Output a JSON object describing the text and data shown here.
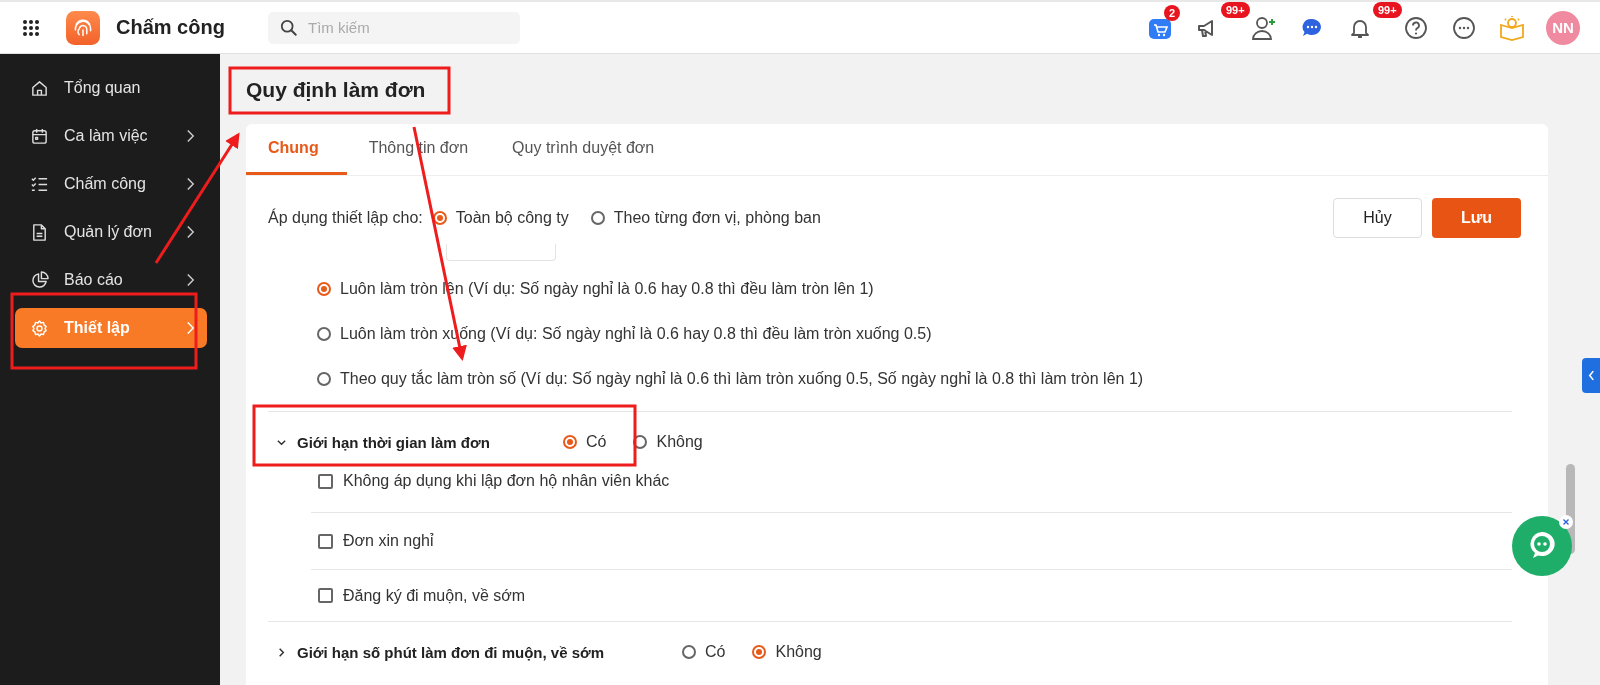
{
  "header": {
    "app_name": "Chấm công",
    "search": {
      "placeholder": "Tìm kiếm"
    },
    "badges": [
      {
        "kind": "cart",
        "count": "2"
      },
      {
        "kind": "megaphone",
        "count": "99+"
      },
      {
        "kind": "add-user"
      },
      {
        "kind": "chat"
      },
      {
        "kind": "bell",
        "count": "99+"
      },
      {
        "kind": "help"
      },
      {
        "kind": "more"
      },
      {
        "kind": "guide"
      }
    ],
    "avatar": "NN"
  },
  "sidebar": {
    "items": [
      {
        "label": "Tổng quan",
        "expandable": false,
        "selected": false
      },
      {
        "label": "Ca làm việc",
        "expandable": true,
        "selected": false
      },
      {
        "label": "Chấm công",
        "expandable": true,
        "selected": false
      },
      {
        "label": "Quản lý đơn",
        "expandable": true,
        "selected": false
      },
      {
        "label": "Báo cáo",
        "expandable": true,
        "selected": false
      },
      {
        "label": "Thiết lập",
        "expandable": true,
        "selected": true
      }
    ]
  },
  "page_title": "Quy định làm đơn",
  "tabs": [
    {
      "label": "Chung",
      "selected": true
    },
    {
      "label": "Thông tin đơn",
      "selected": false
    },
    {
      "label": "Quy trình duyệt đơn",
      "selected": false
    }
  ],
  "apply_to": {
    "label": "Áp dụng thiết lập cho:",
    "options": [
      {
        "label": "Toàn bộ công ty",
        "selected": true
      },
      {
        "label": "Theo từng đơn vị, phòng ban",
        "selected": false
      }
    ]
  },
  "buttons": {
    "cancel": "Hủy",
    "save": "Lưu"
  },
  "rounding_options": [
    {
      "label": "Luôn làm tròn lên (Ví dụ: Số ngày nghỉ là 0.6 hay 0.8 thì đều làm tròn lên 1)",
      "selected": true
    },
    {
      "label": "Luôn làm tròn xuống (Ví dụ: Số ngày nghỉ là 0.6 hay 0.8 thì đều làm tròn xuống 0.5)",
      "selected": false
    },
    {
      "label": "Theo quy tắc làm tròn số (Ví dụ: Số ngày nghỉ là 0.6 thì làm tròn xuống 0.5, Số ngày nghỉ là 0.8 thì làm tròn lên 1)",
      "selected": false
    }
  ],
  "sections": [
    {
      "title": "Giới hạn thời gian làm đơn",
      "expanded": true,
      "options": [
        {
          "label": "Có",
          "selected": true
        },
        {
          "label": "Không",
          "selected": false
        }
      ],
      "checkboxes": [
        {
          "label": "Không áp dụng khi lập đơn hộ nhân viên khác",
          "checked": false
        },
        {
          "label": "Đơn xin nghỉ",
          "checked": false
        },
        {
          "label": "Đăng ký đi muộn, về sớm",
          "checked": false
        }
      ]
    },
    {
      "title": "Giới hạn số phút làm đơn đi muộn, về sớm",
      "expanded": false,
      "options": [
        {
          "label": "Có",
          "selected": false
        },
        {
          "label": "Không",
          "selected": true
        }
      ]
    }
  ]
}
